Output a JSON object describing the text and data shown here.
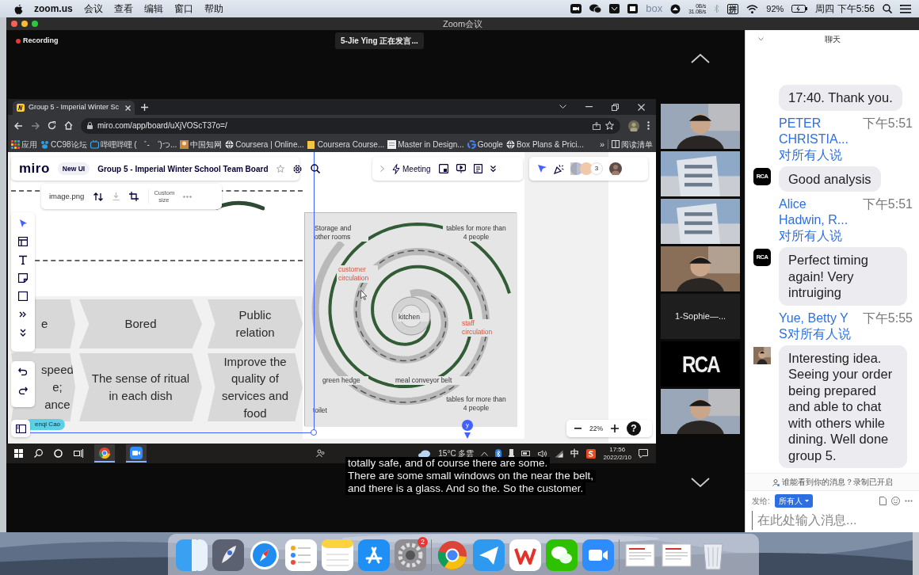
{
  "menubar": {
    "app": "zoom.us",
    "menus": [
      "会议",
      "查看",
      "编辑",
      "窗口",
      "帮助"
    ],
    "box_label": "box",
    "net_up": "0B/s",
    "net_down": "31.0B/s",
    "input_method": "拼",
    "battery": "92%",
    "clock": "周四 下午5:56"
  },
  "window": {
    "title": "Zoom会议"
  },
  "meeting": {
    "recording": "Recording",
    "speaker": "5-Jie Ying 正在发言...",
    "captions": [
      "totally safe, and of course there are some.",
      "There are some small windows on the near the belt,",
      "and there is a glass. And so the. So the customer."
    ]
  },
  "browser": {
    "tab_title": "Group 5 - Imperial Winter Sc",
    "url": "miro.com/app/board/uXjVOScT37o=/",
    "bookmarks": [
      {
        "kind": "apps",
        "label": "应用"
      },
      {
        "kind": "paw",
        "label": "CC98论坛"
      },
      {
        "kind": "tv",
        "label": "哔哩哔哩 ( ゜- ゜)つ..."
      },
      {
        "label": "中国知网"
      },
      {
        "kind": "globe",
        "label": "Coursera | Online..."
      },
      {
        "kind": "note",
        "label": "Coursera Course..."
      },
      {
        "kind": "page",
        "label": "Master in Design..."
      },
      {
        "kind": "google",
        "label": "Google"
      },
      {
        "kind": "globe",
        "label": "Box Plans & Prici..."
      }
    ],
    "overflow": "»",
    "reading_list": "阅读清单"
  },
  "miro": {
    "logo": "miro",
    "badge": "New UI",
    "board_title": "Group 5 - Imperial Winter School Team Board",
    "meeting": "Meeting",
    "collaborator_count": "3",
    "image_name": "image.png",
    "custom_size": "Custom size",
    "user_tag": "enqi Cao",
    "cursor_label": "y",
    "zoom_level": "22%",
    "help": "?"
  },
  "board": {
    "rows": [
      [
        "e",
        "Bored",
        "Public relation"
      ],
      [
        "speed e; ance",
        "The sense of ritual in each dish",
        "Improve the quality of services and food"
      ]
    ],
    "plan_labels": [
      {
        "text": "Storage and other rooms",
        "kind": "area"
      },
      {
        "text": "tables for more than 4 people",
        "kind": "area"
      },
      {
        "text": "customer circulation",
        "kind": "circulation"
      },
      {
        "text": "kitchen",
        "kind": "area"
      },
      {
        "text": "staff circulation",
        "kind": "circulation"
      },
      {
        "text": "green hedge",
        "kind": "area"
      },
      {
        "text": "meal conveyor belt",
        "kind": "area"
      },
      {
        "text": "toilet",
        "kind": "area"
      },
      {
        "text": "tables for more than 4 people",
        "kind": "area"
      }
    ]
  },
  "taskbar": {
    "apps": [
      {
        "kind": "chrome",
        "active": true
      },
      {
        "kind": "zoom",
        "active": true
      }
    ],
    "weather": "15°C 多雲",
    "ime": "中",
    "time": "17:56",
    "date": "2022/2/10"
  },
  "gallery": [
    {
      "kind": "picture"
    },
    {
      "kind": "picture"
    },
    {
      "kind": "picture"
    },
    {
      "kind": "picture"
    },
    {
      "kind": "name",
      "label": "1-Sophie—..."
    },
    {
      "kind": "logo",
      "label": "RCA"
    },
    {
      "kind": "picture"
    }
  ],
  "chat": {
    "title": "聊天",
    "messages": [
      {
        "text": "17:40. Thank you."
      },
      {
        "sender": "PETER CHRISTIA...",
        "recipient": "对所有人说",
        "time": "下午5:51",
        "avatar": {
          "kind": "logo",
          "label": "RCA"
        },
        "text": "Good analysis"
      },
      {
        "sender": "Alice Hadwin, R...",
        "recipient": "对所有人说",
        "time": "下午5:51",
        "avatar": {
          "kind": "logo",
          "label": "RCA"
        },
        "text": "Perfect timing again! Very intruiging"
      },
      {
        "sender": "Yue, Betty Y S",
        "recipient": "对所有人说",
        "time": "下午5:55",
        "avatar": {
          "kind": "picture"
        },
        "text": "Interesting idea. Seeing your order being prepared and able to chat with others while dining.  Well done group 5."
      }
    ],
    "notice": "谁能看到你的消息？录制已开启",
    "send_to_label": "发给:",
    "send_to": "所有人",
    "placeholder": "在此处输入消息..."
  },
  "dock": [
    {
      "kind": "finder"
    },
    {
      "kind": "launchpad"
    },
    {
      "kind": "safari"
    },
    {
      "kind": "reminders"
    },
    {
      "kind": "notes"
    },
    {
      "kind": "appstore"
    },
    {
      "kind": "settings",
      "badge": "2"
    },
    {
      "kind": "separator"
    },
    {
      "kind": "chrome"
    },
    {
      "kind": "paperplane"
    },
    {
      "kind": "wps"
    },
    {
      "kind": "wechat"
    },
    {
      "kind": "zoom"
    },
    {
      "kind": "separator"
    },
    {
      "kind": "document"
    },
    {
      "kind": "document"
    },
    {
      "kind": "trash"
    }
  ]
}
